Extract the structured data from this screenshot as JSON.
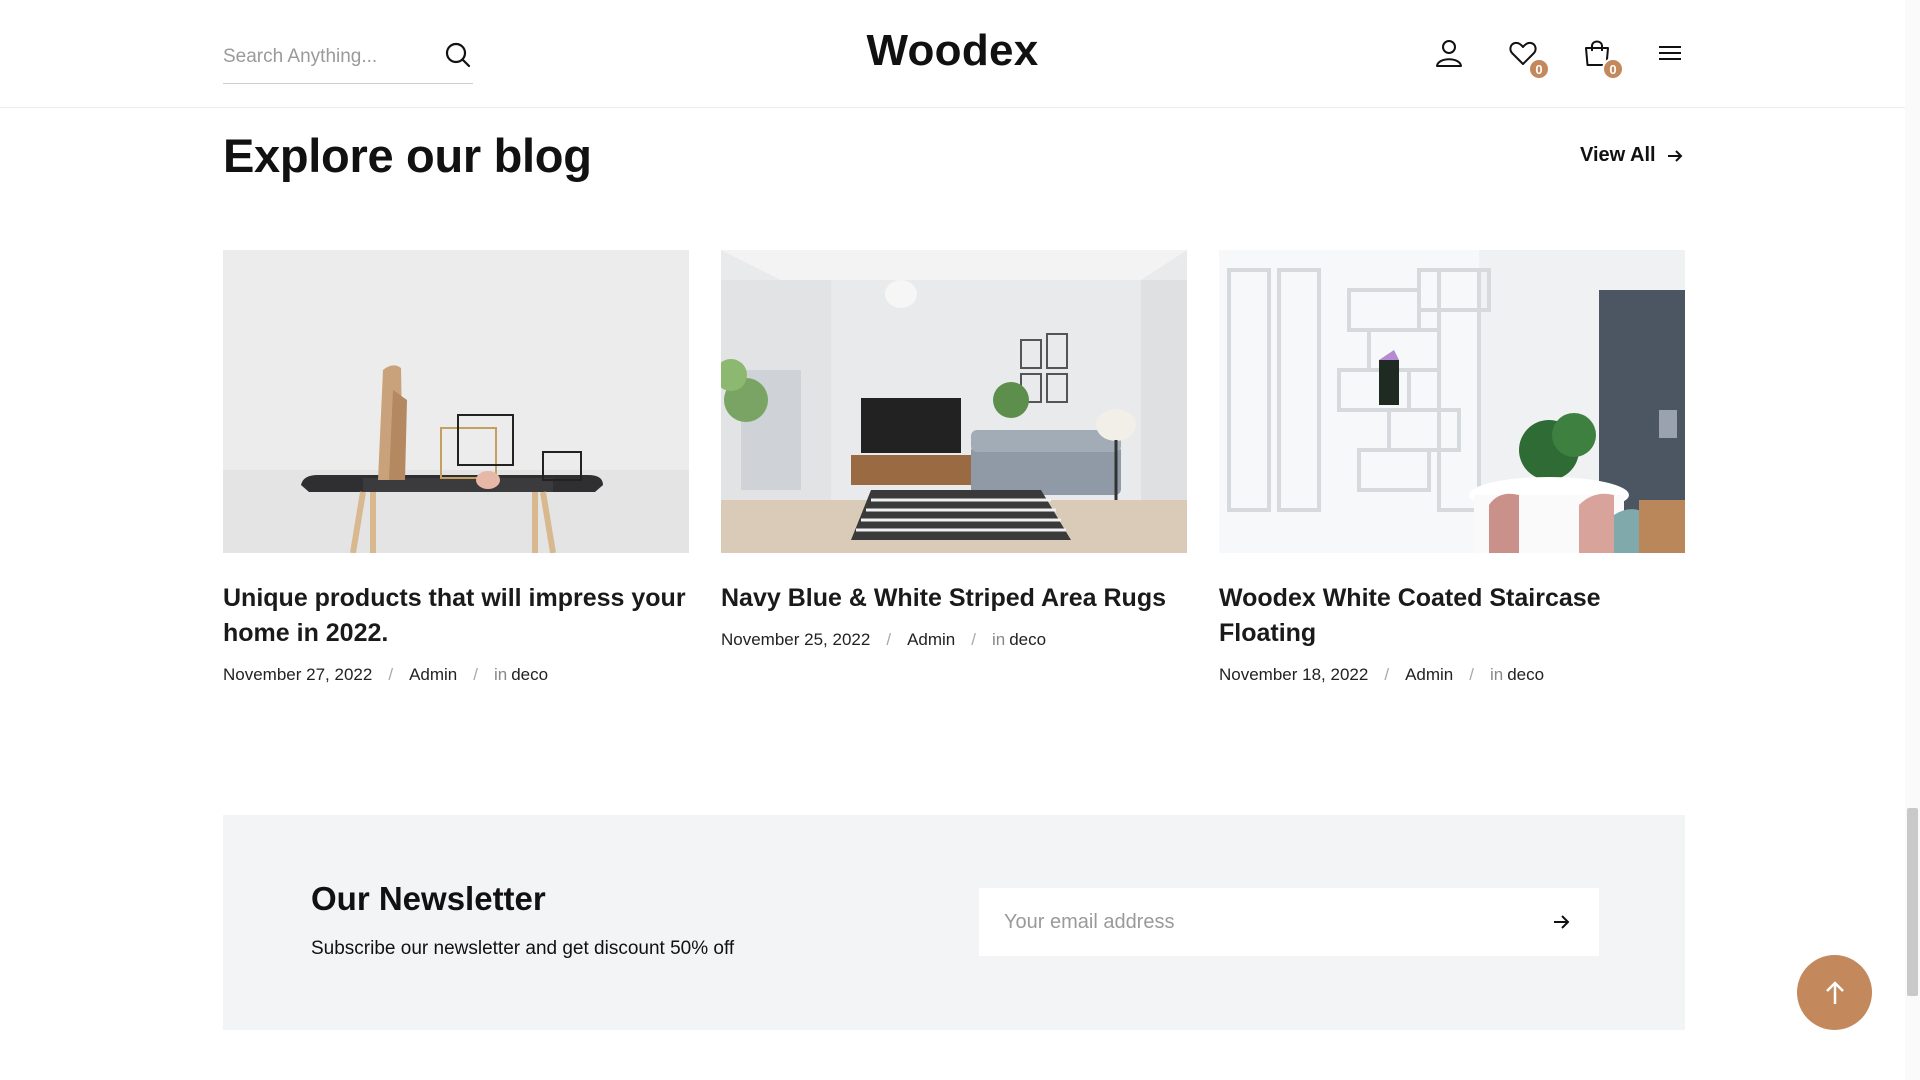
{
  "header": {
    "search_placeholder": "Search Anything...",
    "logo": "Woodex",
    "wishlist_count": "0",
    "cart_count": "0",
    "icons": [
      "search-icon",
      "user-icon",
      "heart-icon",
      "shopping-bag-icon",
      "menu-icon"
    ]
  },
  "blog": {
    "title": "Explore our blog",
    "view_all": "View All",
    "posts": [
      {
        "title": "Unique products that will impress your home in 2022.",
        "date": "November 27, 2022",
        "author": "Admin",
        "in_label": "in",
        "category": "deco"
      },
      {
        "title": "Navy Blue & White Striped Area Rugs",
        "date": "November 25, 2022",
        "author": "Admin",
        "in_label": "in",
        "category": "deco"
      },
      {
        "title": "Woodex White Coated Staircase Floating",
        "date": "November 18, 2022",
        "author": "Admin",
        "in_label": "in",
        "category": "deco"
      }
    ]
  },
  "newsletter": {
    "title": "Our Newsletter",
    "subtitle": "Subscribe our newsletter and get discount 50% off",
    "email_placeholder": "Your email address"
  },
  "colors": {
    "accent": "#c4885d",
    "newsletter_bg": "#f3f4f5",
    "text": "#111111"
  },
  "separator": "/"
}
